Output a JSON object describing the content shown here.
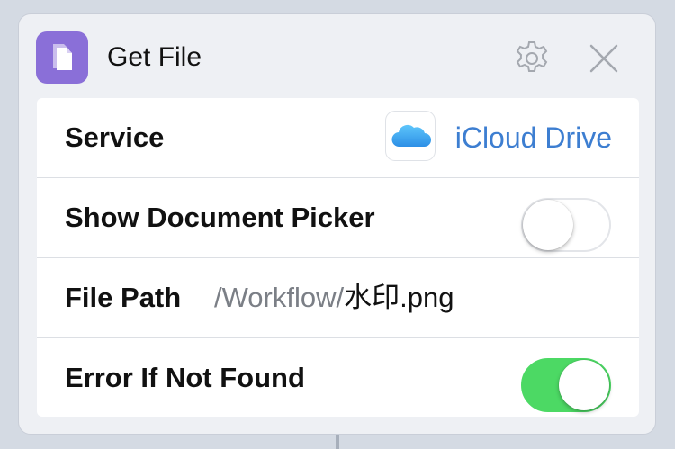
{
  "action": {
    "title": "Get File",
    "icon": "document-icon",
    "accent_color": "#8a6fd8"
  },
  "header": {
    "settings_icon": "gear-icon",
    "close_icon": "close-icon"
  },
  "rows": {
    "service": {
      "label": "Service",
      "value": "iCloud Drive",
      "icon": "icloud-icon",
      "value_color": "#3d7ed1"
    },
    "show_picker": {
      "label": "Show Document Picker",
      "enabled": false
    },
    "file_path": {
      "label": "File Path",
      "folder_prefix": "/Workflow/",
      "file_name": "水印.png"
    },
    "error_if_not_found": {
      "label": "Error If Not Found",
      "enabled": true,
      "on_color": "#4cd964"
    }
  }
}
